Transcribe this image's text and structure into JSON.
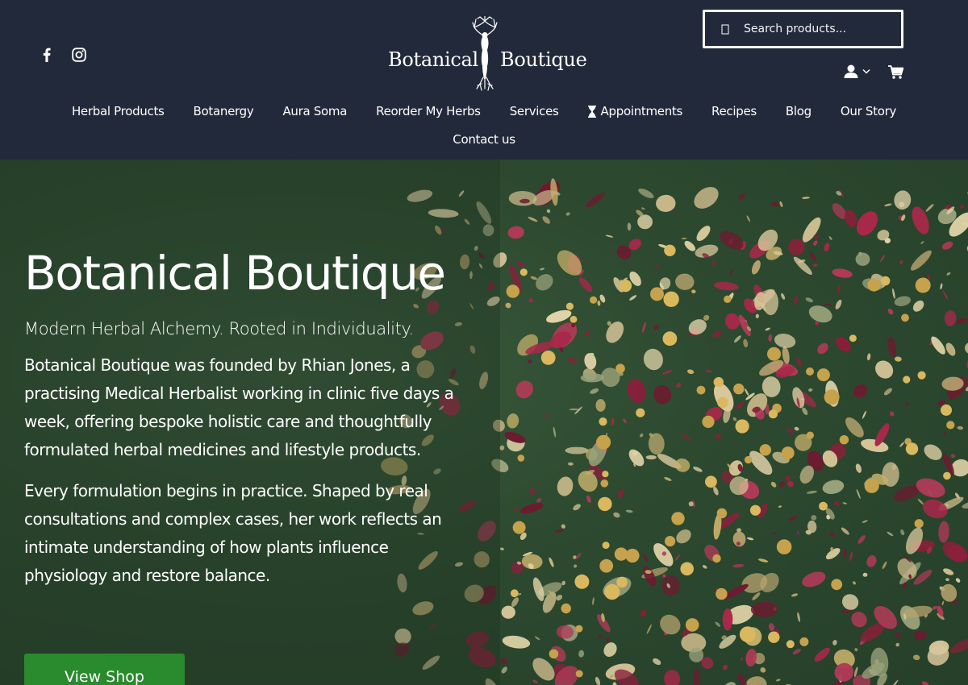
{
  "header": {
    "logo": {
      "left_text": "Botanical",
      "right_text": "Boutique"
    },
    "social": [
      {
        "icon": "facebook-icon"
      },
      {
        "icon": "instagram-icon"
      }
    ],
    "search": {
      "placeholder": "Search products..."
    },
    "nav": [
      {
        "label": "Herbal Products"
      },
      {
        "label": "Botanergy"
      },
      {
        "label": "Aura Soma"
      },
      {
        "label": "Reorder My Herbs"
      },
      {
        "label": "Services"
      },
      {
        "label": "Appointments",
        "icon": "hourglass-icon"
      },
      {
        "label": "Recipes"
      },
      {
        "label": "Blog"
      },
      {
        "label": "Our Story"
      }
    ],
    "nav_row2": [
      {
        "label": "Contact us"
      }
    ]
  },
  "hero": {
    "title": "Botanical Boutique",
    "tagline": "Modern Herbal Alchemy. Rooted in Individuality.",
    "paragraph1": "Botanical Boutique was founded by Rhian Jones, a practising Medical Herbalist working in clinic five days a week, offering bespoke holistic care and thoughtfully formulated herbal medicines and lifestyle products.",
    "paragraph2": "Every formulation begins in practice. Shaped by real consultations and complex cases, her work reflects an intimate understanding of how plants influence physiology and restore balance.",
    "button_label": "View Shop"
  },
  "colors": {
    "header_bg": "#22293a",
    "hero_bg": "#2d4a30",
    "button_bg": "#2a8a2e",
    "text": "#ffffff"
  }
}
